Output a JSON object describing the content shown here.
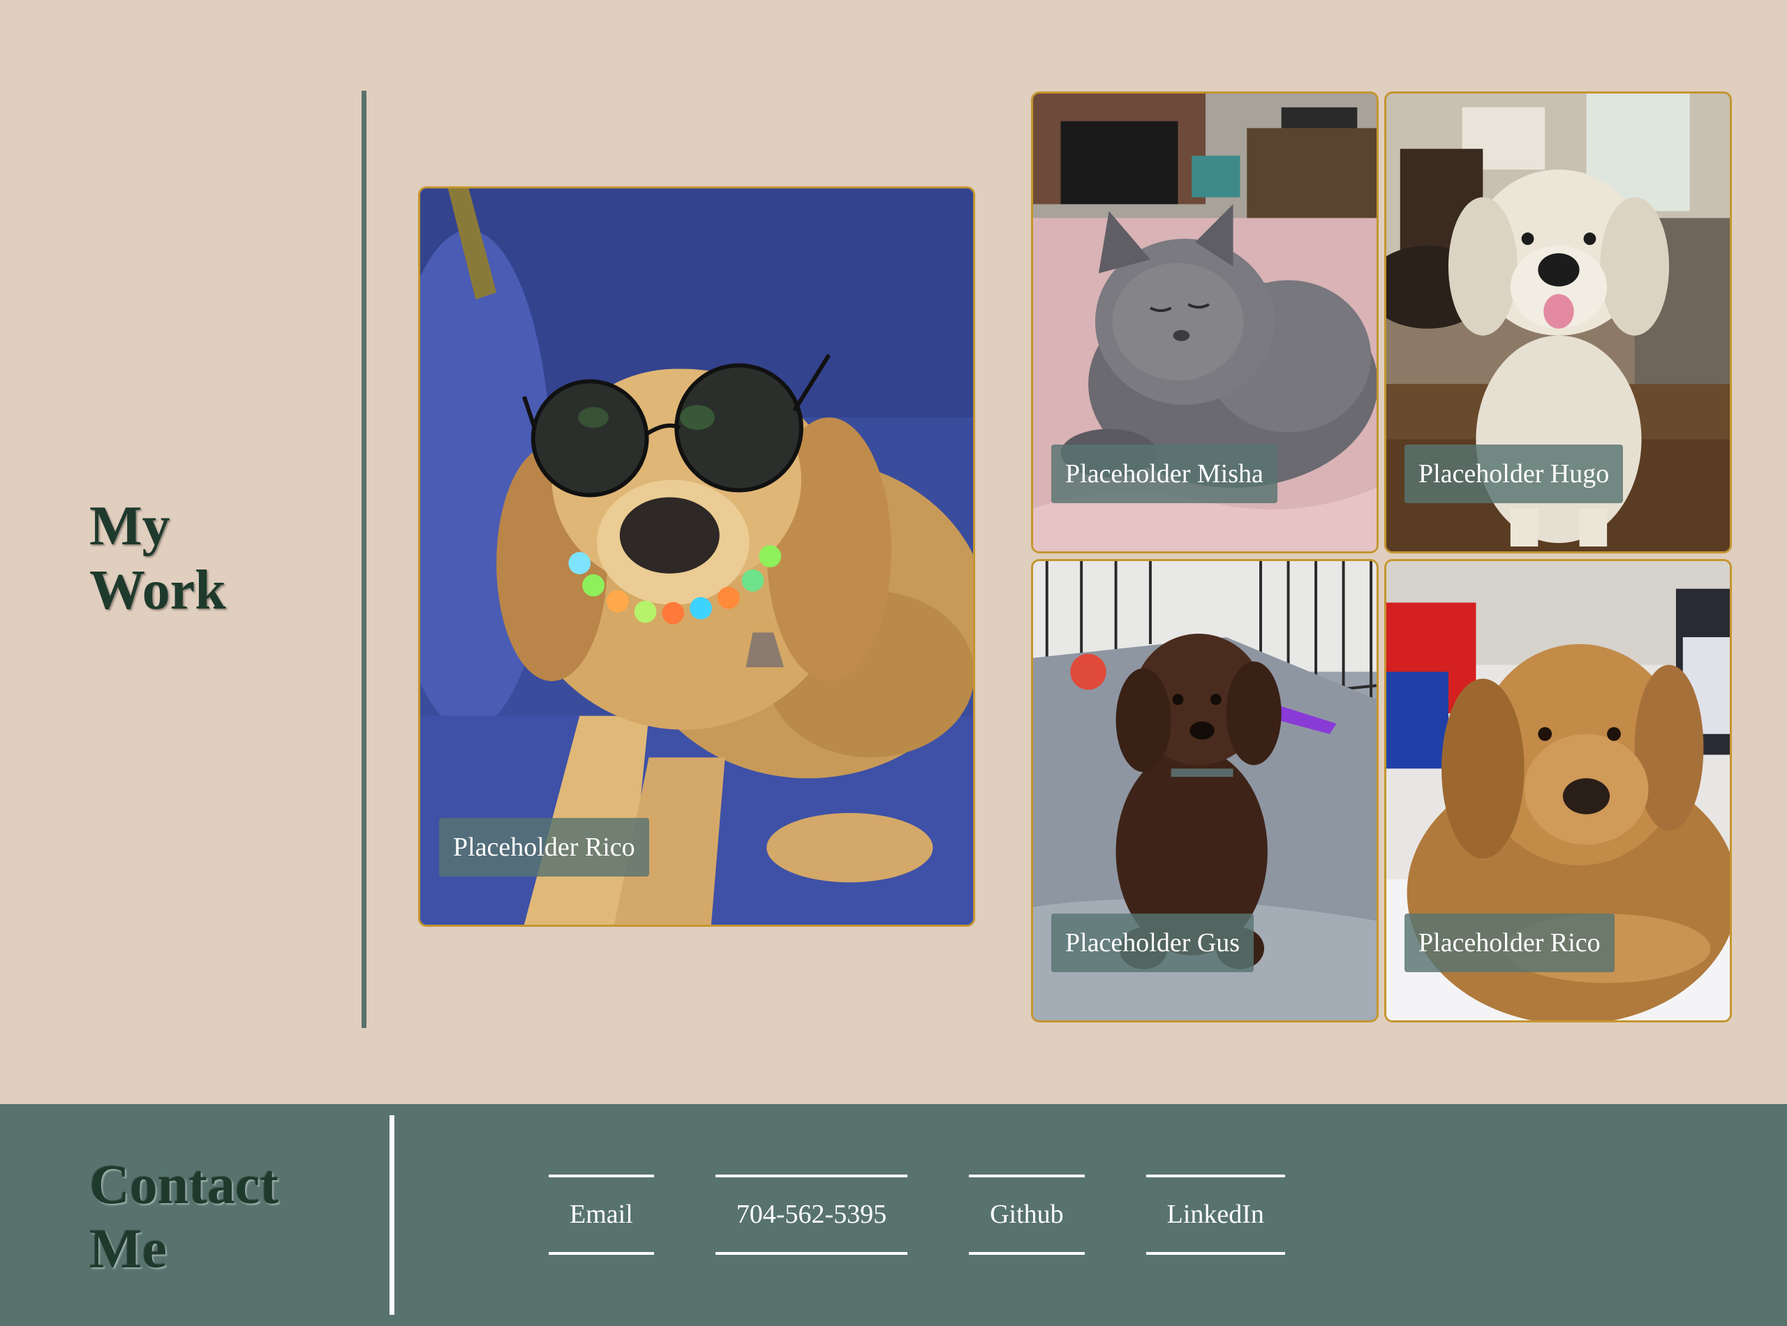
{
  "work": {
    "title": "My Work",
    "gallery": [
      {
        "id": "rico-large",
        "caption": "Placeholder Rico",
        "subject": "golden retriever wearing sunglasses on blue couch"
      },
      {
        "id": "misha",
        "caption": "Placeholder Misha",
        "subject": "grey cat on pink blanket"
      },
      {
        "id": "hugo",
        "caption": "Placeholder Hugo",
        "subject": "white golden retriever sitting in living room"
      },
      {
        "id": "gus",
        "caption": "Placeholder Gus",
        "subject": "brown doodle puppy on grey blanket"
      },
      {
        "id": "rico-small",
        "caption": "Placeholder Rico",
        "subject": "golden retriever lying on bed"
      }
    ]
  },
  "contact": {
    "title": "Contact Me",
    "links": [
      {
        "label": "Email"
      },
      {
        "label": "704-562-5395"
      },
      {
        "label": "Github"
      },
      {
        "label": "LinkedIn"
      }
    ]
  },
  "colors": {
    "page_background": "#e0cebe",
    "footer_background": "#58736e",
    "heading": "#1e3a2c",
    "card_border": "#c4962f",
    "caption_background": "#587470"
  }
}
